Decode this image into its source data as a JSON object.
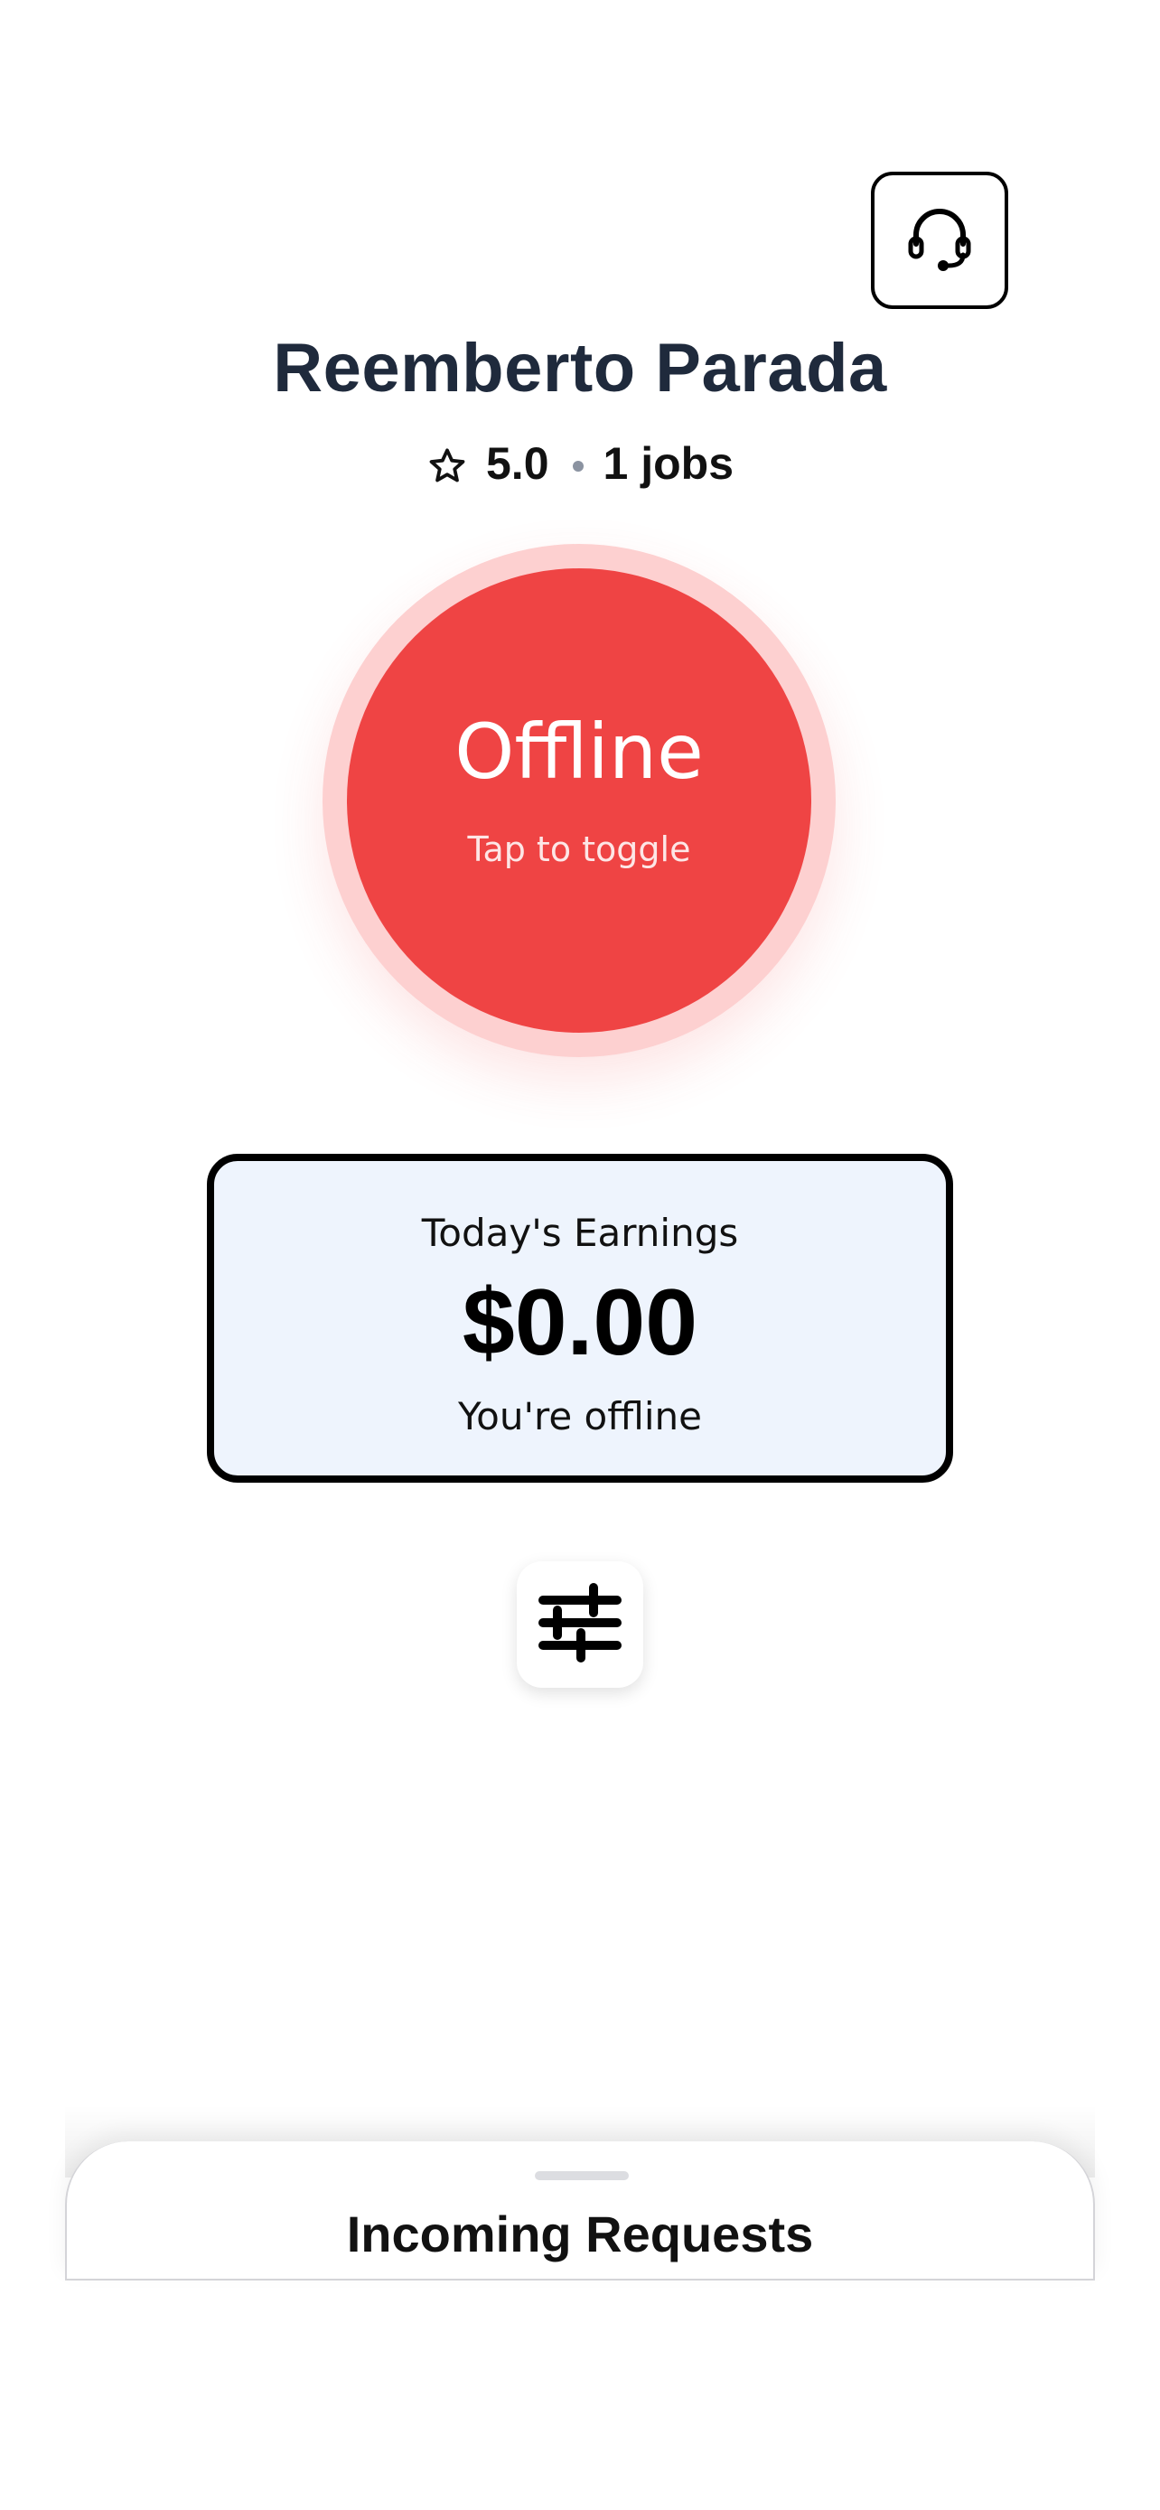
{
  "header": {
    "support_icon": "headset-icon"
  },
  "driver": {
    "name": "Reemberto Parada",
    "rating": "5.0",
    "jobs": "1 jobs",
    "rating_icon": "star-outline-icon"
  },
  "status_toggle": {
    "status": "Offline",
    "hint": "Tap to toggle",
    "color": "#ef4444",
    "halo_color": "#fdd0d0"
  },
  "earnings": {
    "label": "Today's Earnings",
    "amount": "$0.00",
    "status": "You're offline",
    "background": "#eef4fd"
  },
  "filter": {
    "icon": "sliders-icon"
  },
  "bottom_sheet": {
    "title": "Incoming Requests"
  }
}
